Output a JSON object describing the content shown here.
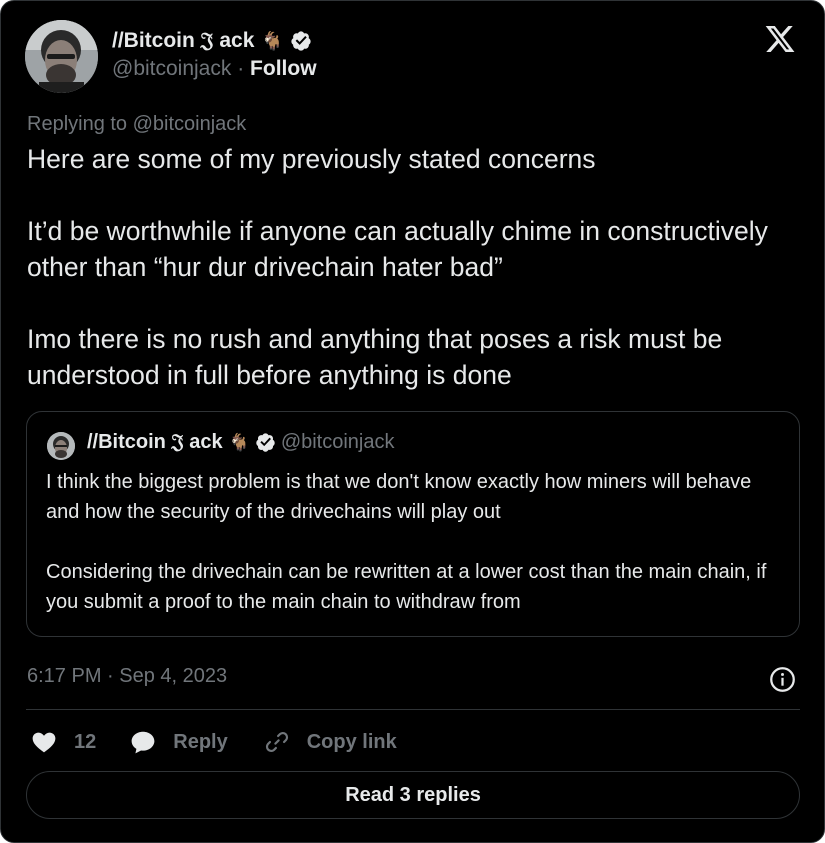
{
  "author": {
    "display_name": "//Bitcoin 𝔍 ack",
    "handle": "@bitcoinjack",
    "follow_label": "Follow",
    "separator": " · "
  },
  "reply_to": "Replying to @bitcoinjack",
  "tweet": {
    "text": "Here are some of my previously stated concerns\n\nIt’d be worthwhile if anyone can actually chime in constructively other than “hur dur drivechain hater bad”\n\nImo there is no rush and anything that poses a risk must be understood in full before anything is done"
  },
  "quote": {
    "display_name": "//Bitcoin 𝔍 ack",
    "handle": "@bitcoinjack",
    "text": "I think the biggest problem is that we don't know exactly how miners will behave and how the security of the drivechains will play out\n\nConsidering the drivechain can be rewritten at a lower cost than the main chain, if you submit a proof to the main chain to withdraw from"
  },
  "timestamp": "6:17 PM · Sep 4, 2023",
  "actions": {
    "like_count": "12",
    "reply_label": "Reply",
    "copy_label": "Copy link"
  },
  "read_replies_label": "Read 3 replies",
  "icons": {
    "verified": "verified-badge-icon",
    "goat": "goat-emoji-icon",
    "x_logo": "x-logo-icon",
    "info": "info-icon",
    "heart": "heart-icon",
    "reply": "reply-bubble-icon",
    "link": "link-icon"
  },
  "colors": {
    "background": "#000000",
    "text": "#e7e9ea",
    "muted": "#71767b",
    "border": "#2f3336"
  }
}
